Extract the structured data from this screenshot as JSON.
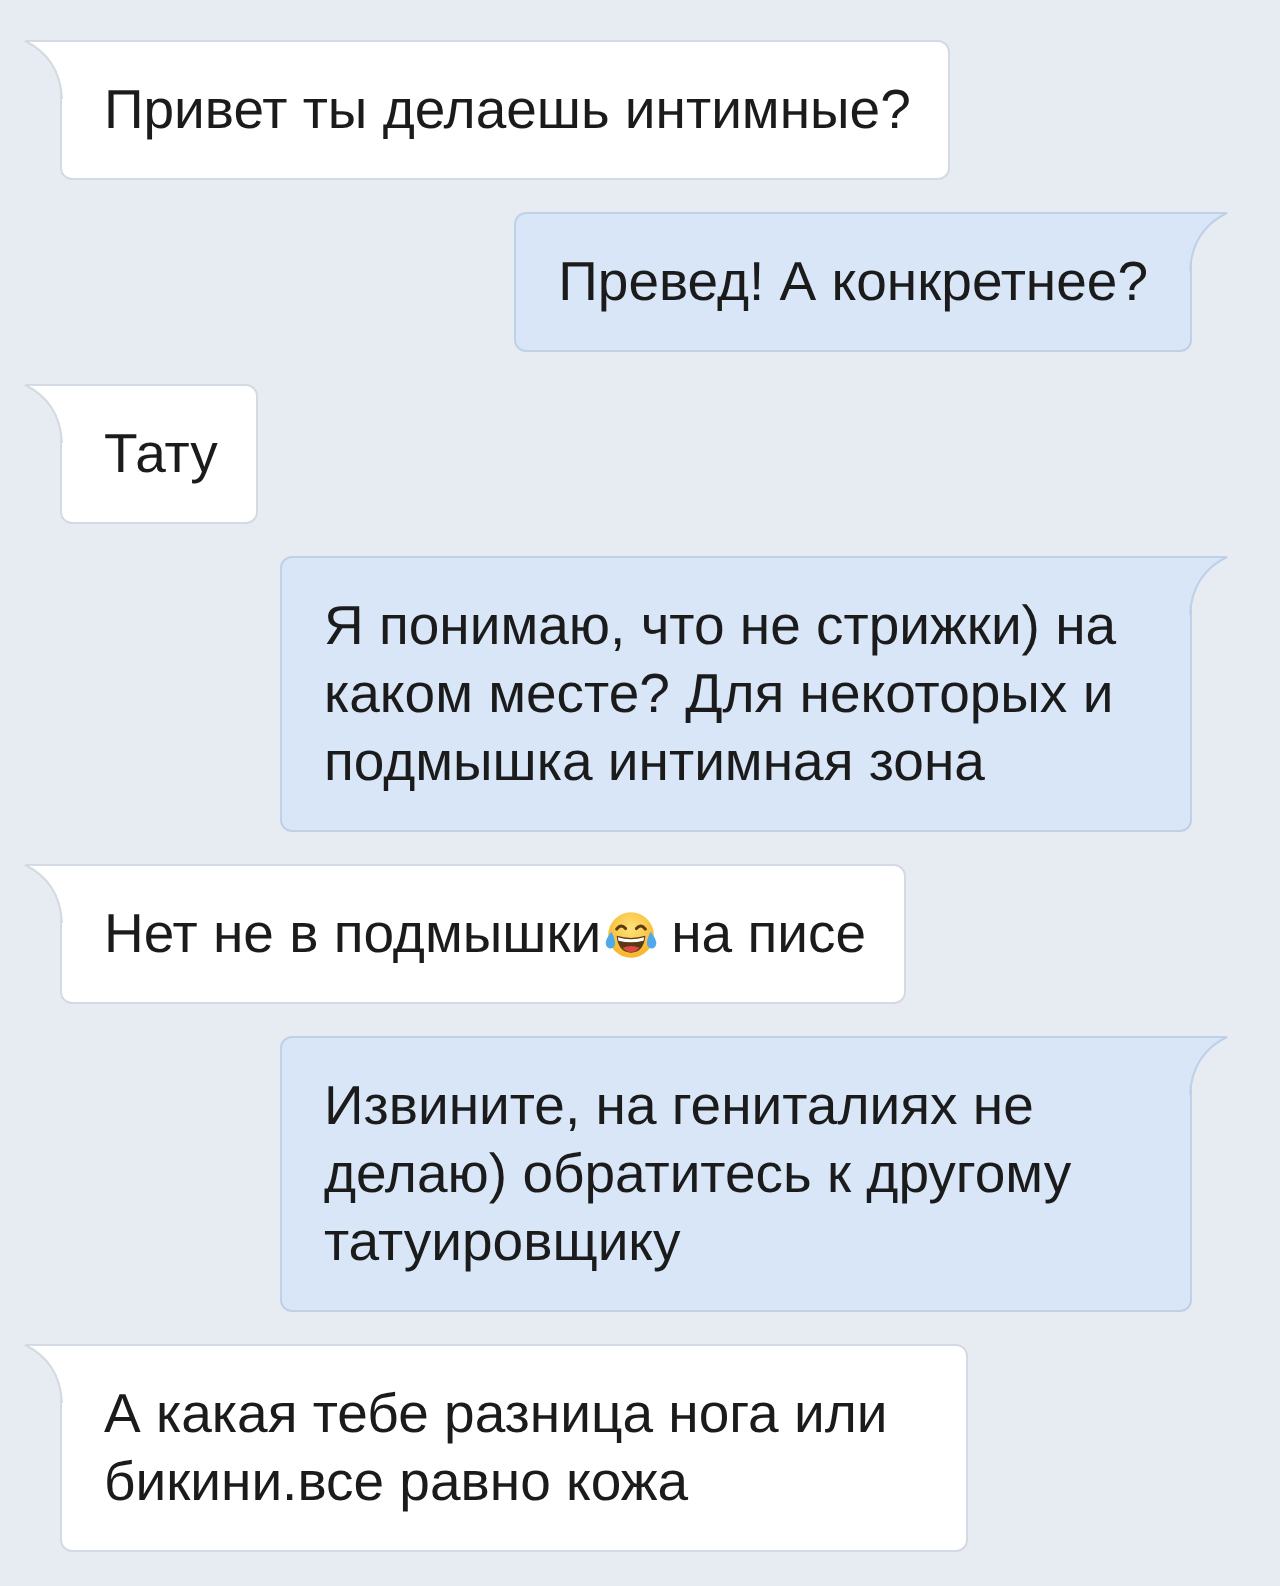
{
  "messages": [
    {
      "outgoing": false,
      "segments": [
        {
          "kind": "text",
          "text": "Привет ты делаешь интимные?"
        }
      ]
    },
    {
      "outgoing": true,
      "segments": [
        {
          "kind": "text",
          "text": "Превед! А конкретнее?"
        }
      ]
    },
    {
      "outgoing": false,
      "segments": [
        {
          "kind": "text",
          "text": "Тату"
        }
      ]
    },
    {
      "outgoing": true,
      "segments": [
        {
          "kind": "text",
          "text": "Я понимаю, что не стрижки) на каком месте? Для некоторых и подмышка интимная зона"
        }
      ]
    },
    {
      "outgoing": false,
      "segments": [
        {
          "kind": "text",
          "text": "Нет не в подмышки"
        },
        {
          "kind": "emoji"
        },
        {
          "kind": "text",
          "text": "на писе"
        }
      ]
    },
    {
      "outgoing": true,
      "segments": [
        {
          "kind": "text",
          "text": "Извините, на гениталиях не делаю) обратитесь к другому татуировщику"
        }
      ]
    },
    {
      "outgoing": false,
      "segments": [
        {
          "kind": "text",
          "text": "А какая тебе разница нога или бикини.все равно кожа"
        }
      ]
    }
  ]
}
